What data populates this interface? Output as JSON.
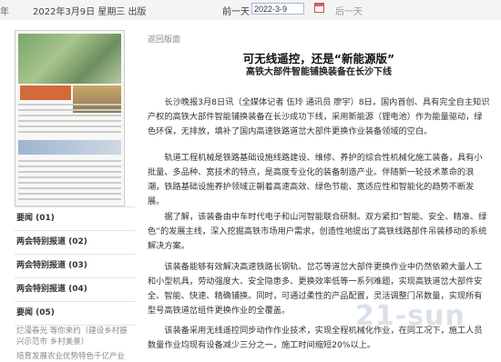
{
  "topbar": {
    "left_fragment": "年",
    "issue_date": "2022年3月9日 星期三 出版",
    "prev_label": "前一天",
    "date_value": "2022-3-9",
    "next_label": "后一天"
  },
  "sidebar": {
    "items": [
      {
        "label": "要闻 (01)"
      },
      {
        "label": "两会特别报道 (02)"
      },
      {
        "label": "两会特别报道 (03)"
      },
      {
        "label": "两会特别报道 (04)"
      },
      {
        "label": "要闻 (05)"
      }
    ],
    "sublinks": [
      "烂漫春光 等你来约（建设乡村振兴示范市 乡村美景）",
      "培育发展农业优势特色千亿产业"
    ]
  },
  "article": {
    "back_label": "返回版面",
    "title": "可无线遥控，还是“新能源版”",
    "subtitle": "高铁大部件智能铺换装备在长沙下线",
    "paragraphs": [
      "长沙晚报3月8日讯（全媒体记者 伍玲 通讯员 廖宇）8日，国内首创、具有完全自主知识产权的高铁大部件智能铺换装备在长沙成功下线，采用新能源（锂电池）作为能量驱动，绿色环保，无排放，填补了国内高速铁路道岔大部件更换作业装备领域的空白。",
      "轨道工程机械是铁路基础设施线路建设、维修、养护的综合性机械化施工装备，具有小批量、多品种、宽技术的特点，是高度专业化的装备制造产业。伴随新一轮技术革命的浪潮，铁路基础设施养护领域正朝着高速高效、绿色节能、宽适应性和智能化的趋势不断发展。",
      "据了解，该装备由中车时代电子和山河智能联合研制。双方紧扣“智能、安全、精准、绿色”的发展主线，深入挖掘高铁市场用户需求，创造性地提出了高铁线路部件吊装移动的系统解决方案。",
      "该装备能够有效解决高速铁路长钢轨、岔芯等道岔大部件更换作业中仍然依赖大量人工和小型机具，劳动强度大、安全隐患多、更换效率低等一系列难题，实现高铁道岔大部件安全、智能、快速、精确铺换。同时，可通过柔性的产品配置，灵活调整门吊数量，实现所有型号高铁道岔组件更换作业的全覆盖。",
      "该装备采用无线遥控同步动作作业技术，实现全程机械化作业，在同工况下，施工人员数量作业均现有设备减少三分之一，施工时间缩短20%以上。"
    ]
  },
  "watermark": "21-sun"
}
